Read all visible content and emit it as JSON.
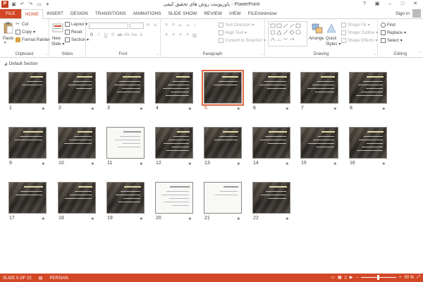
{
  "window": {
    "title": "پاورپوینت روش های تحقیق کیفی - PowerPoint"
  },
  "quick_access": [
    "save-icon",
    "undo-icon",
    "redo-icon",
    "start-from-beginning-icon",
    "customize-icon"
  ],
  "tabs": [
    "FILE",
    "HOME",
    "INSERT",
    "DESIGN",
    "TRANSITIONS",
    "ANIMATIONS",
    "SLIDE SHOW",
    "REVIEW",
    "VIEW",
    "FILEminimizer"
  ],
  "active_tab": "HOME",
  "account": {
    "signin": "Sign in"
  },
  "ribbon": {
    "clipboard": {
      "label": "Clipboard",
      "paste": "Paste",
      "cut": "Cut",
      "copy": "Copy",
      "format_painter": "Format Painter"
    },
    "slides": {
      "label": "Slides",
      "new_slide": "New",
      "new_slide2": "Slide",
      "layout": "Layout",
      "reset": "Reset",
      "section": "Section"
    },
    "font": {
      "label": "Font"
    },
    "paragraph": {
      "label": "Paragraph",
      "text_direction": "Text Direction",
      "align_text": "Align Text",
      "convert_smartart": "Convert to SmartArt"
    },
    "drawing": {
      "label": "Drawing",
      "arrange": "Arrange",
      "quick_styles": "Quick",
      "quick_styles2": "Styles",
      "shape_fill": "Shape Fill",
      "shape_outline": "Shape Outline",
      "shape_effects": "Shape Effects"
    },
    "editing": {
      "label": "Editing",
      "find": "Find",
      "replace": "Replace",
      "select": "Select"
    }
  },
  "sorter": {
    "section_name": "Default Section",
    "selected_slide": 5,
    "slides": [
      {
        "num": "1"
      },
      {
        "num": "2"
      },
      {
        "num": "3"
      },
      {
        "num": "4"
      },
      {
        "num": "5"
      },
      {
        "num": "6"
      },
      {
        "num": "7"
      },
      {
        "num": "8"
      },
      {
        "num": "9"
      },
      {
        "num": "10"
      },
      {
        "num": "11"
      },
      {
        "num": "12"
      },
      {
        "num": "13"
      },
      {
        "num": "14"
      },
      {
        "num": "15"
      },
      {
        "num": "16"
      },
      {
        "num": "17"
      },
      {
        "num": "18"
      },
      {
        "num": "19"
      },
      {
        "num": "20"
      },
      {
        "num": "21"
      },
      {
        "num": "22"
      }
    ],
    "star_glyph": "★"
  },
  "status": {
    "slide_of": "SLIDE 5 OF 22",
    "language": "PERSIAN",
    "zoom": "50 %"
  },
  "colors": {
    "accent": "#d24726",
    "selection": "#e26a45"
  }
}
